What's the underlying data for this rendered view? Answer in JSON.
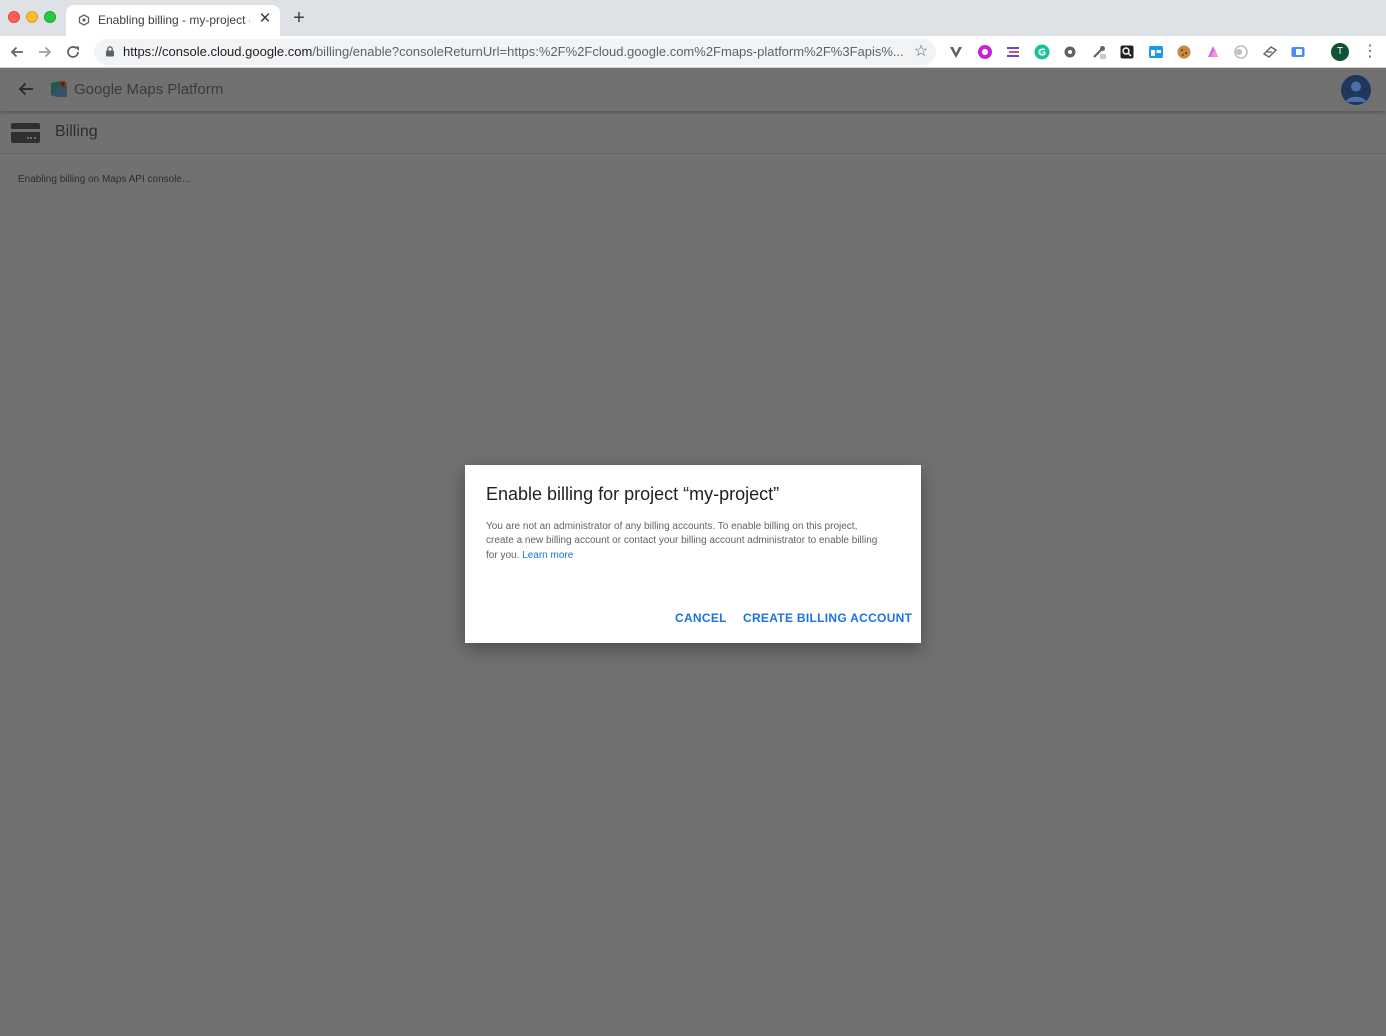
{
  "browser": {
    "tab_title": "Enabling billing - my-project - Google Cloud Platform",
    "tab_close": "✕",
    "new_tab": "+",
    "url_domain": "https://console.cloud.google.com",
    "url_path": "/billing/enable?consoleReturnUrl=https:%2F%2Fcloud.google.com%2Fmaps-platform%2F%3Fapis%...",
    "profile_initial": "T",
    "extensions": [
      "vimeo-extension",
      "pink-extension",
      "stack-extension",
      "grammarly-extension",
      "gear-extension",
      "eyedropper-extension",
      "search-extension",
      "window-extension",
      "cookie-extension",
      "gradient-extension",
      "circle-extension",
      "shield-extension",
      "blue-extension"
    ]
  },
  "app": {
    "title": "Google Maps Platform",
    "page_title": "Billing",
    "status_text": "Enabling billing on Maps API console..."
  },
  "dialog": {
    "title": "Enable billing for project “my-project”",
    "body": "You are not an administrator of any billing accounts. To enable billing on this project, create a new billing account or contact your billing account administrator to enable billing for you.",
    "link_text": "Learn more",
    "cancel_label": "CANCEL",
    "create_label": "CREATE BILLING ACCOUNT"
  },
  "colors": {
    "overlay_bg": "#717171",
    "accent_blue": "#1a73e8"
  }
}
